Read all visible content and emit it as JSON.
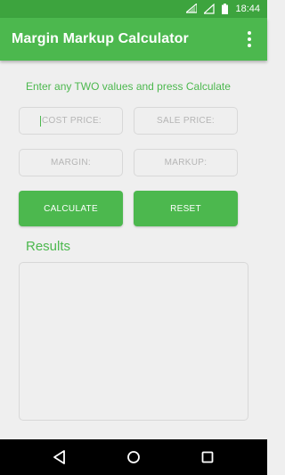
{
  "status_bar": {
    "time": "18:44",
    "icons": [
      "wifi-icon",
      "signal-icon",
      "battery-icon"
    ]
  },
  "app_bar": {
    "title": "Margin Markup Calculator",
    "menu_icon": "more-vert-icon"
  },
  "form": {
    "instruction": "Enter any TWO values and press Calculate",
    "cost_price_placeholder": "COST PRICE:",
    "sale_price_placeholder": "SALE PRICE:",
    "margin_placeholder": "MARGIN:",
    "markup_placeholder": "MARKUP:"
  },
  "buttons": {
    "calculate_label": "CALCULATE",
    "reset_label": "RESET"
  },
  "results": {
    "title": "Results",
    "content": ""
  },
  "nav_bar": {
    "icons": [
      "back-icon",
      "home-icon",
      "recents-icon"
    ]
  },
  "colors": {
    "primary": "#4CB84E",
    "primary_dark": "#3DA43E",
    "background": "#EFEFEF"
  }
}
